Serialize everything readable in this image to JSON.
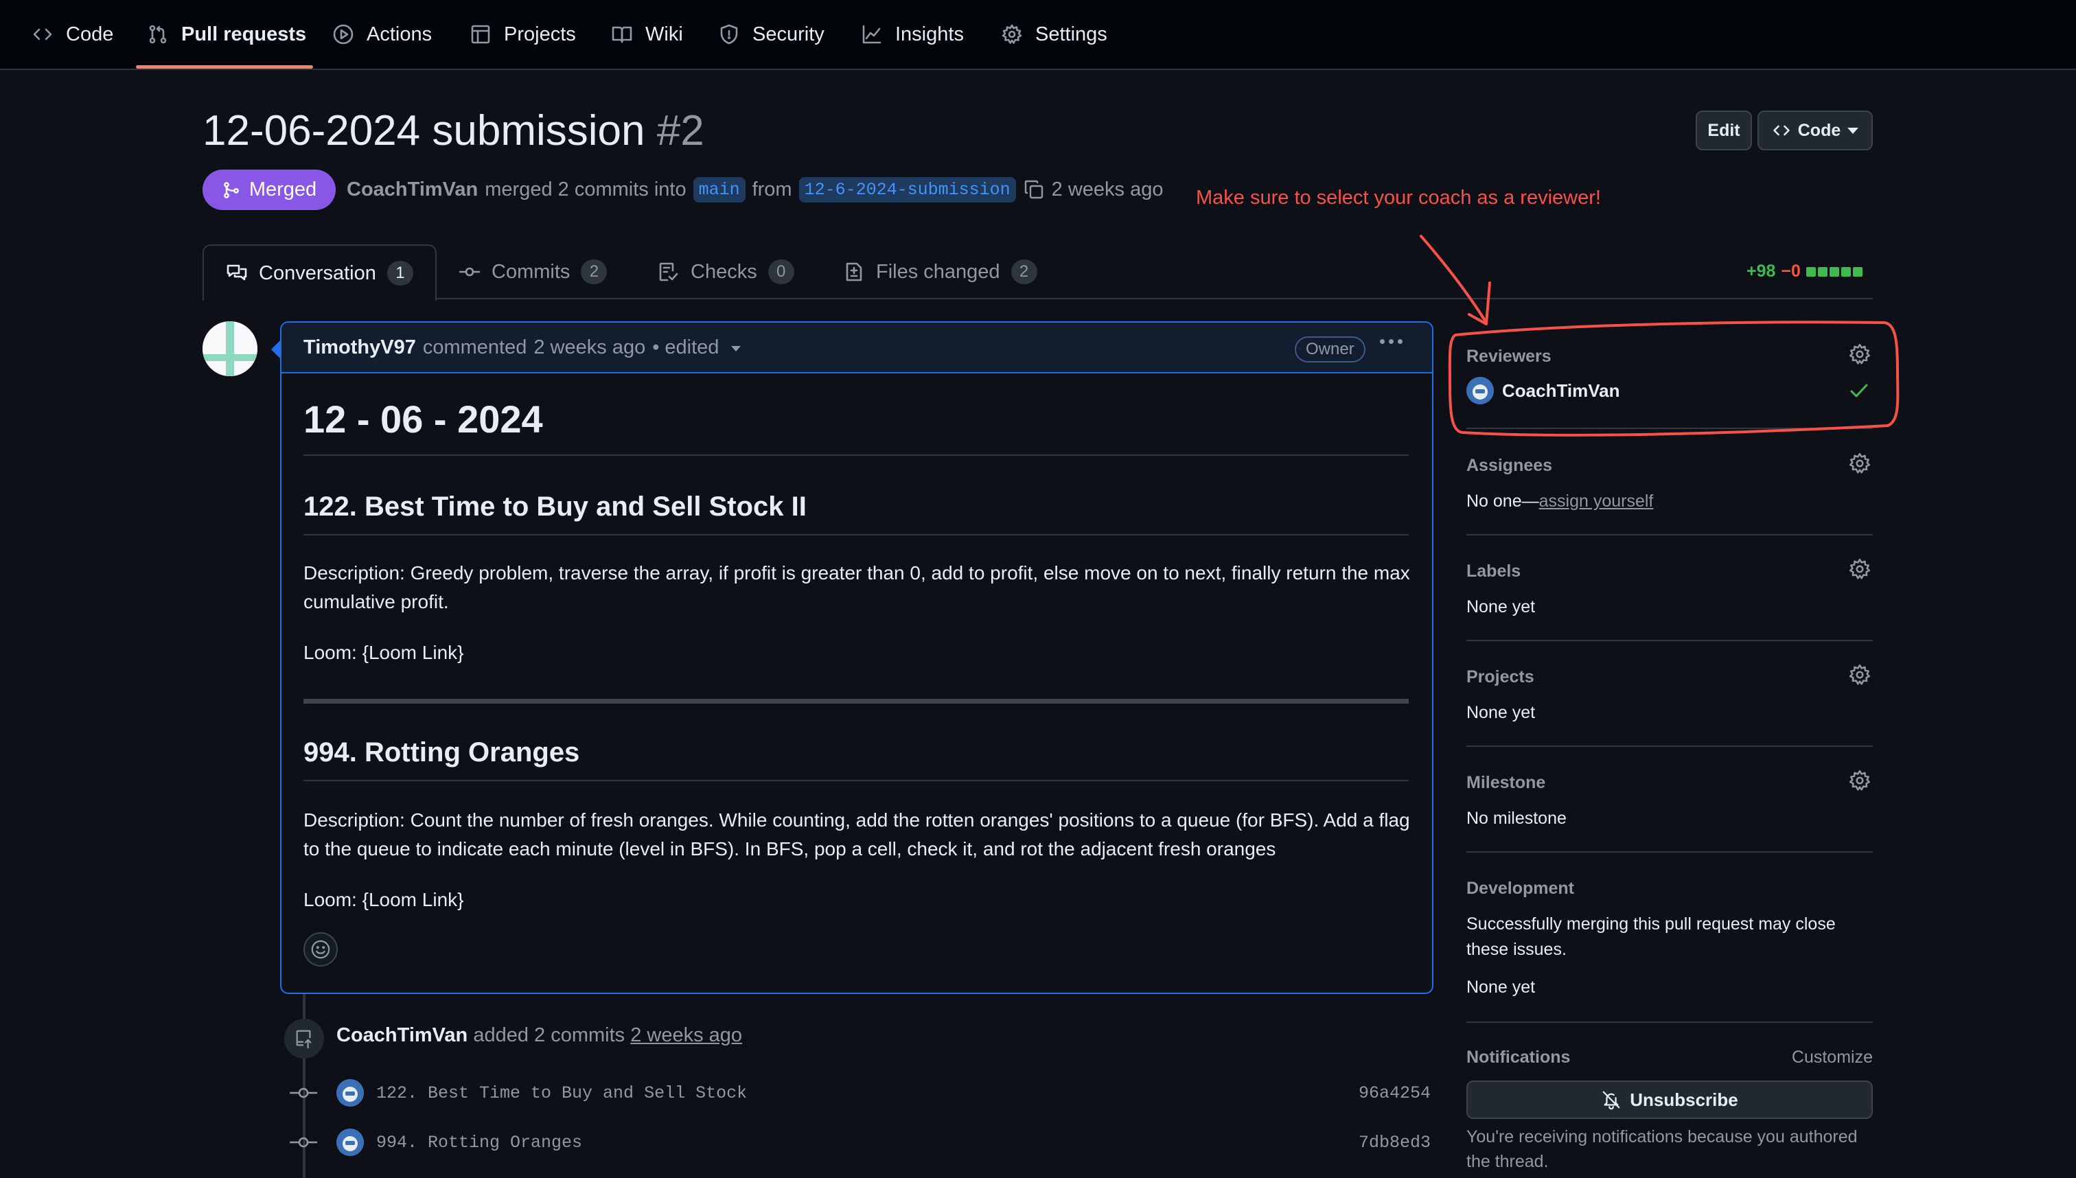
{
  "nav": {
    "items": [
      {
        "label": "Code",
        "icon": "code-icon"
      },
      {
        "label": "Pull requests",
        "icon": "git-pull-request-icon",
        "active": true
      },
      {
        "label": "Actions",
        "icon": "play-icon"
      },
      {
        "label": "Projects",
        "icon": "table-icon"
      },
      {
        "label": "Wiki",
        "icon": "book-icon"
      },
      {
        "label": "Security",
        "icon": "shield-icon"
      },
      {
        "label": "Insights",
        "icon": "graph-icon"
      },
      {
        "label": "Settings",
        "icon": "gear-icon"
      }
    ]
  },
  "header": {
    "title": "12-06-2024 submission",
    "number": "#2",
    "edit_label": "Edit",
    "code_label": "Code",
    "state_label": "Merged",
    "author": "CoachTimVan",
    "merged_text": "merged 2 commits into",
    "base_branch": "main",
    "from_text": "from",
    "head_branch": "12-6-2024-submission",
    "time_ago": "2 weeks ago",
    "annotation": "Make sure to select your coach as a reviewer!"
  },
  "tabs": [
    {
      "label": "Conversation",
      "count": "1",
      "icon": "comment-discussion-icon",
      "active": true
    },
    {
      "label": "Commits",
      "count": "2",
      "icon": "git-commit-icon"
    },
    {
      "label": "Checks",
      "count": "0",
      "icon": "checklist-icon"
    },
    {
      "label": "Files changed",
      "count": "2",
      "icon": "file-diff-icon"
    }
  ],
  "diffstat": {
    "additions": "+98",
    "deletions": "−0"
  },
  "comment": {
    "author": "TimothyV97",
    "action": "commented",
    "time": "2 weeks ago",
    "edited": "• edited",
    "role_badge": "Owner",
    "h1": "12 - 06 - 2024",
    "sections": [
      {
        "heading": "122. Best Time to Buy and Sell Stock II",
        "description": "Description: Greedy problem, traverse the array, if profit is greater than 0, add to profit, else move on to next, finally return the max cumulative profit.",
        "loom": "Loom: {Loom Link}"
      },
      {
        "heading": "994. Rotting Oranges",
        "description": "Description: Count the number of fresh oranges. While counting, add the rotten oranges' positions to a queue (for BFS). Add a flag to the queue to indicate each minute (level in BFS). In BFS, pop a cell, check it, and rot the adjacent fresh oranges",
        "loom": "Loom: {Loom Link}"
      }
    ]
  },
  "timeline": {
    "event_author": "CoachTimVan",
    "event_text": "added 2 commits",
    "event_time": "2 weeks ago",
    "commits": [
      {
        "message": "122. Best Time to Buy and Sell Stock",
        "sha": "96a4254"
      },
      {
        "message": "994. Rotting Oranges",
        "sha": "7db8ed3"
      }
    ]
  },
  "sidebar": {
    "reviewers": {
      "title": "Reviewers",
      "name": "CoachTimVan"
    },
    "assignees": {
      "title": "Assignees",
      "value": "No one—",
      "link": "assign yourself"
    },
    "labels": {
      "title": "Labels",
      "value": "None yet"
    },
    "projects": {
      "title": "Projects",
      "value": "None yet"
    },
    "milestone": {
      "title": "Milestone",
      "value": "No milestone"
    },
    "development": {
      "title": "Development",
      "note": "Successfully merging this pull request may close these issues.",
      "value": "None yet"
    },
    "notifications": {
      "title": "Notifications",
      "customize": "Customize",
      "button": "Unsubscribe",
      "note": "You're receiving notifications because you authored the thread."
    }
  },
  "colors": {
    "accent_merged": "#8957e5",
    "annotation_red": "#f85149",
    "link_blue": "#4493f8",
    "success_green": "#3fb950"
  }
}
